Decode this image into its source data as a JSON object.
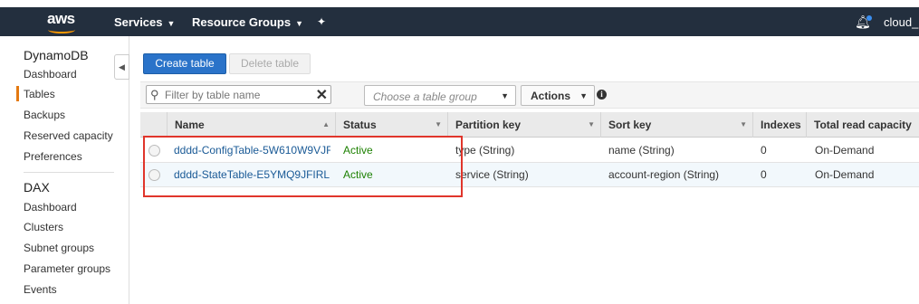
{
  "topnav": {
    "logo": "aws",
    "services_label": "Services",
    "resource_groups_label": "Resource Groups",
    "pin_icon": "pin-icon",
    "bell_icon": "bell-icon",
    "account_label": "cloud_"
  },
  "sidebar": {
    "dynamodb_heading": "DynamoDB",
    "dynamodb_items": [
      "Dashboard",
      "Tables",
      "Backups",
      "Reserved capacity",
      "Preferences"
    ],
    "active_item": "Tables",
    "dax_heading": "DAX",
    "dax_items": [
      "Dashboard",
      "Clusters",
      "Subnet groups",
      "Parameter groups",
      "Events"
    ]
  },
  "main": {
    "create_table_label": "Create table",
    "delete_table_label": "Delete table",
    "filter_placeholder": "Filter by table name",
    "table_group_placeholder": "Choose a table group",
    "actions_label": "Actions",
    "columns": [
      "Name",
      "Status",
      "Partition key",
      "Sort key",
      "Indexes",
      "Total read capacity"
    ],
    "rows": [
      {
        "name": "dddd-ConfigTable-5W610W9VJF",
        "status": "Active",
        "partition_key": "type (String)",
        "sort_key": "name (String)",
        "indexes": "0",
        "read_capacity": "On-Demand"
      },
      {
        "name": "dddd-StateTable-E5YMQ9JFIRL",
        "status": "Active",
        "partition_key": "service (String)",
        "sort_key": "account-region (String)",
        "indexes": "0",
        "read_capacity": "On-Demand"
      }
    ]
  },
  "colors": {
    "nav_bg": "#232f3e",
    "primary_button": "#2a73c9",
    "link": "#1a5a96",
    "status_active": "#1d8102",
    "highlight_box": "#e0352b",
    "sidebar_active_bar": "#e47911"
  }
}
